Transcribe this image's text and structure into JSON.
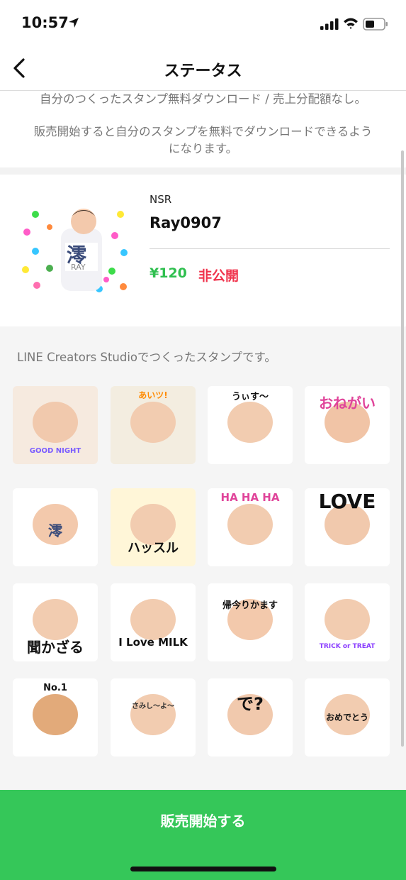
{
  "status_bar": {
    "time": "10:57"
  },
  "nav": {
    "title": "ステータス"
  },
  "info": {
    "line1": "自分のつくったスタンプ無料ダウンロード / 売上分配額なし。",
    "line2a": "販売開始すると自分のスタンプを無料でダウンロードできるよう",
    "line2b": "になります。"
  },
  "pack": {
    "creator": "NSR",
    "name": "Ray0907",
    "price": "¥120",
    "visibility": "非公開",
    "main_sticker": {
      "kanji": "澪",
      "caption": "RAY"
    }
  },
  "studio_note": "LINE Creators Studioでつくったスタンプです。",
  "stickers": [
    {
      "text": "GOOD NIGHT"
    },
    {
      "text": "あいツ!"
    },
    {
      "text": "うぃす〜"
    },
    {
      "text": "おねがい"
    },
    {
      "text": "澪"
    },
    {
      "text": "ハッスル"
    },
    {
      "text": "HA HA HA"
    },
    {
      "text": "LOVE"
    },
    {
      "text": "聞かざる"
    },
    {
      "text": "I Love MILK"
    },
    {
      "text": "帰今りかます"
    },
    {
      "text": "TRICK or TREAT"
    },
    {
      "text": "No.1"
    },
    {
      "text": "さみし〜よ〜"
    },
    {
      "text": "で?"
    },
    {
      "text": "おめでとう"
    }
  ],
  "colors": {
    "sell_button": "#35c759",
    "price": "#2fbf4f",
    "private": "#f0334c"
  },
  "sell_button": {
    "label": "販売開始する"
  }
}
